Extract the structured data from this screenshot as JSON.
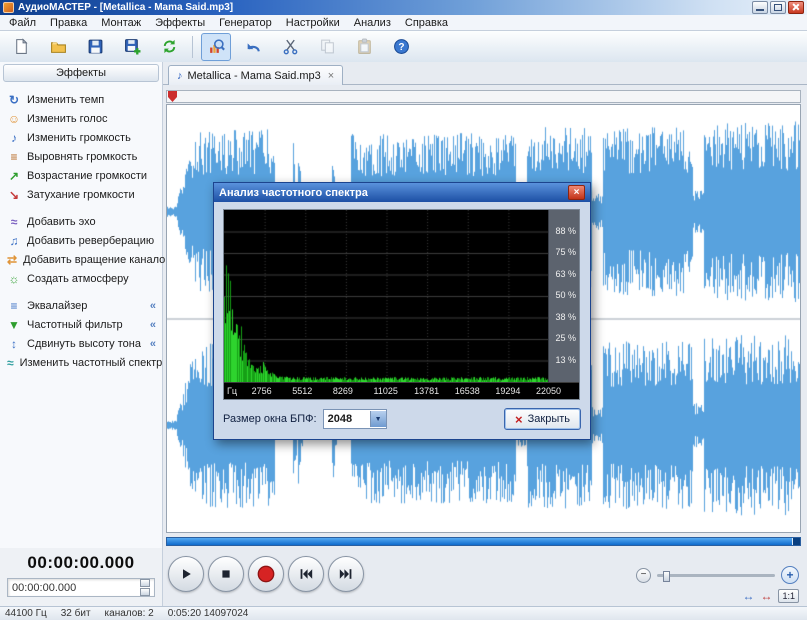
{
  "window": {
    "title": "АудиоМАСТЕР - [Metallica - Mama Said.mp3]"
  },
  "menu": {
    "items": [
      "Файл",
      "Правка",
      "Монтаж",
      "Эффекты",
      "Генератор",
      "Настройки",
      "Анализ",
      "Справка"
    ]
  },
  "toolbar": {
    "buttons": [
      {
        "name": "new-file-button",
        "icon": "new-document-icon",
        "enabled": true
      },
      {
        "name": "open-file-button",
        "icon": "open-folder-icon",
        "enabled": true
      },
      {
        "name": "save-button",
        "icon": "floppy-disk-icon",
        "enabled": true
      },
      {
        "name": "save-as-button",
        "icon": "floppy-plus-icon",
        "enabled": true
      },
      {
        "name": "convert-button",
        "icon": "convert-arrows-icon",
        "enabled": true,
        "sep_after": true
      },
      {
        "name": "spectrum-analysis-button",
        "icon": "analyze-icon",
        "enabled": true,
        "active": true
      },
      {
        "name": "undo-button",
        "icon": "undo-arrow-icon",
        "enabled": true
      },
      {
        "name": "cut-button",
        "icon": "scissors-icon",
        "enabled": true
      },
      {
        "name": "copy-button",
        "icon": "copy-icon",
        "enabled": false
      },
      {
        "name": "paste-button",
        "icon": "paste-icon",
        "enabled": false
      },
      {
        "name": "help-button",
        "icon": "help-icon",
        "enabled": true
      }
    ]
  },
  "effects_panel": {
    "header": "Эффекты",
    "expander_glyph": "«",
    "items": [
      {
        "label": "Изменить темп",
        "icon": "tempo-icon",
        "glyph": "↻",
        "color": "#3a6fc4"
      },
      {
        "label": "Изменить голос",
        "icon": "voice-icon",
        "glyph": "☺",
        "color": "#e09438"
      },
      {
        "label": "Изменить громкость",
        "icon": "volume-icon",
        "glyph": "♪",
        "color": "#3a6fc4"
      },
      {
        "label": "Выровнять громкость",
        "icon": "normalize-volume-icon",
        "glyph": "≡",
        "color": "#b5651d"
      },
      {
        "label": "Возрастание громкости",
        "icon": "fade-in-icon",
        "glyph": "↗",
        "color": "#2e9e2e"
      },
      {
        "label": "Затухание громкости",
        "icon": "fade-out-icon",
        "glyph": "↘",
        "color": "#c43a3a"
      },
      {
        "label": "Добавить эхо",
        "icon": "echo-icon",
        "glyph": "≈",
        "color": "#7a5fc0",
        "group_start": true
      },
      {
        "label": "Добавить реверберацию",
        "icon": "reverb-icon",
        "glyph": "♫",
        "color": "#3a6fc4"
      },
      {
        "label": "Добавить вращение каналов",
        "icon": "channel-rotate-icon",
        "glyph": "⇄",
        "color": "#e09438"
      },
      {
        "label": "Создать атмосферу",
        "icon": "atmosphere-icon",
        "glyph": "☼",
        "color": "#2e9e2e"
      },
      {
        "label": "Эквалайзер",
        "icon": "equalizer-icon",
        "glyph": "≡",
        "color": "#3a6fc4",
        "group_start": true,
        "has_more": true
      },
      {
        "label": "Частотный фильтр",
        "icon": "frequency-filter-icon",
        "glyph": "▼",
        "color": "#2e9e2e",
        "has_more": true
      },
      {
        "label": "Сдвинуть высоту тона",
        "icon": "pitch-shift-icon",
        "glyph": "↕",
        "color": "#3a6fc4",
        "has_more": true
      },
      {
        "label": "Изменить частотный спектр",
        "icon": "spectrum-edit-icon",
        "glyph": "≈",
        "color": "#2e9e9e"
      }
    ]
  },
  "tab": {
    "icon_glyph": "♪",
    "label": "Metallica - Mama Said.mp3",
    "close_glyph": "×"
  },
  "dialog": {
    "title": "Анализ частотного спектра",
    "close_glyph": "×",
    "y_ticks": [
      "88 %",
      "75 %",
      "63 %",
      "50 %",
      "38 %",
      "25 %",
      "13 %"
    ],
    "x_ticks": [
      "Гц",
      "2756",
      "5512",
      "8269",
      "11025",
      "13781",
      "16538",
      "19294",
      "22050"
    ],
    "fft_label": "Размер окна БПФ:",
    "fft_value": "2048",
    "dropdown_glyph": "▼",
    "button_x_glyph": "×",
    "close_label": "Закрыть"
  },
  "transport": {
    "buttons": [
      {
        "name": "play-button",
        "icon": "play-icon"
      },
      {
        "name": "stop-button",
        "icon": "stop-icon"
      },
      {
        "name": "record-button",
        "icon": "record-icon"
      },
      {
        "name": "skip-back-button",
        "icon": "skip-back-icon"
      },
      {
        "name": "skip-forward-button",
        "icon": "skip-forward-icon"
      }
    ]
  },
  "time": {
    "main": "00:00:00.000",
    "selection": "00:00:00.000"
  },
  "zoom": {
    "minus": "−",
    "plus": "+",
    "arrow_glyph": "↔",
    "ratio": "1:1"
  },
  "status": {
    "items": [
      "44100 Гц",
      "32 бит",
      "каналов: 2",
      "0:05:20 14097024"
    ]
  }
}
